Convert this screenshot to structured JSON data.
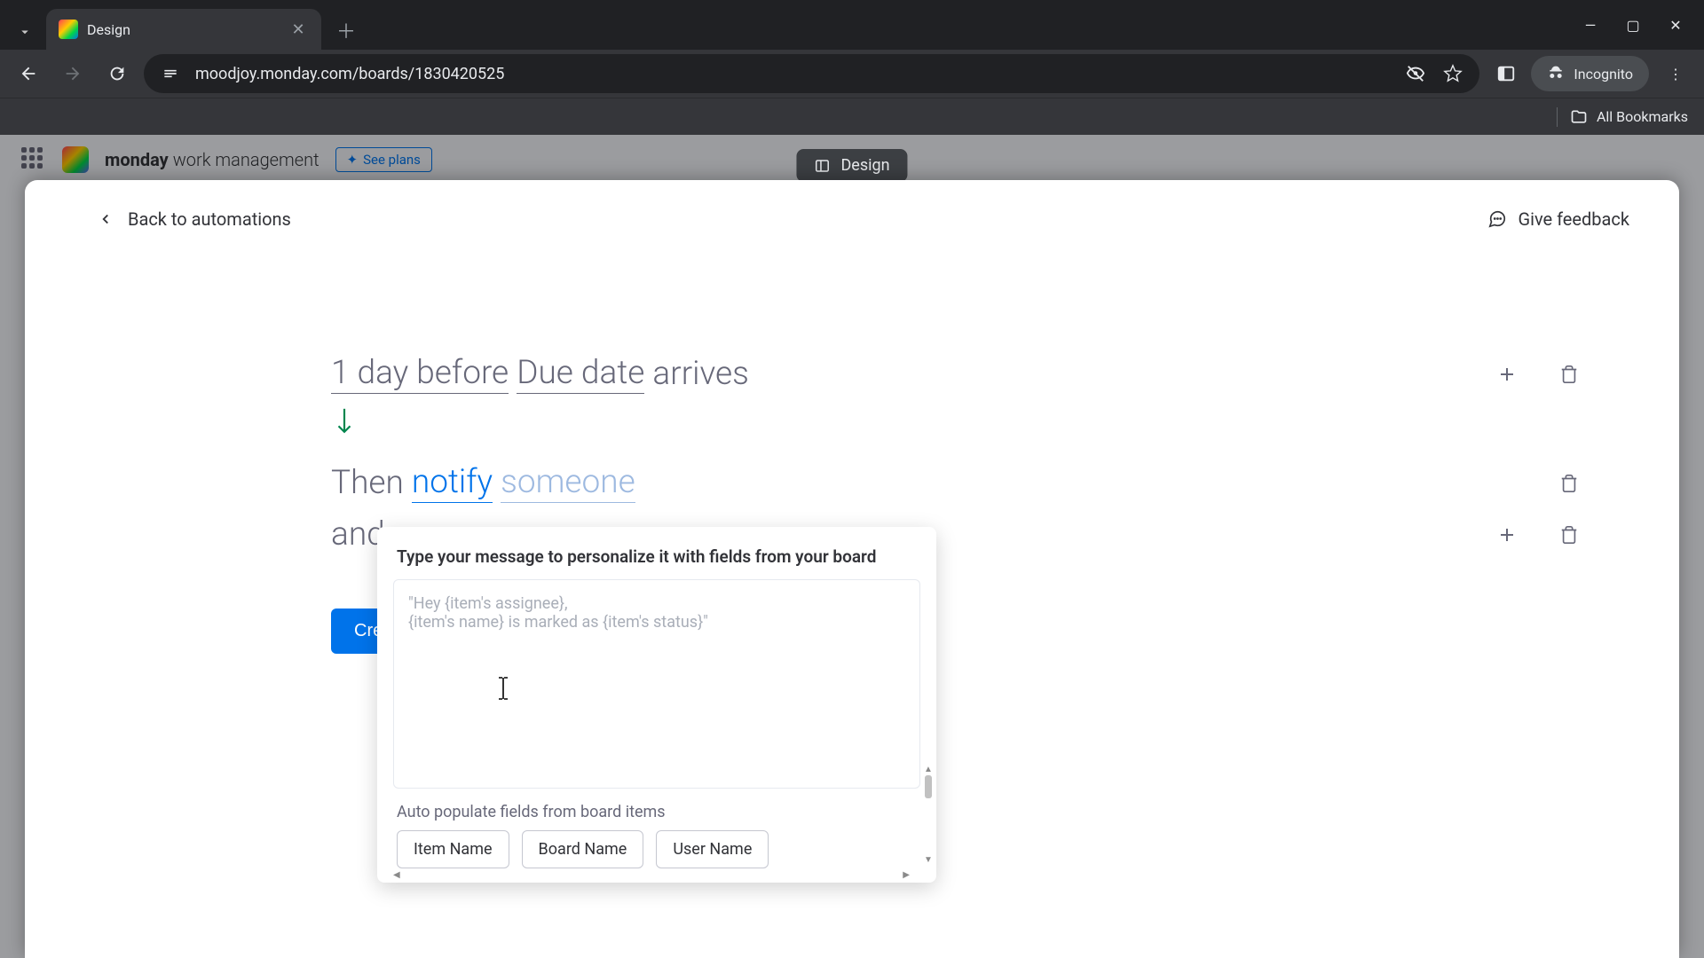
{
  "browser": {
    "tab_title": "Design",
    "url": "moodjoy.monday.com/boards/1830420525",
    "incognito_label": "Incognito",
    "all_bookmarks": "All Bookmarks"
  },
  "page_pill": "Design",
  "monday_header": {
    "brand_bold": "monday",
    "brand_rest": "work management",
    "see_plans": "See plans"
  },
  "modal": {
    "back": "Back to automations",
    "feedback": "Give feedback"
  },
  "automation": {
    "trigger": {
      "time": "1 day before",
      "date_field": "Due date",
      "suffix": "arrives"
    },
    "action1": {
      "prefix": "Then",
      "verb": "notify",
      "target": "someone"
    },
    "action2": {
      "prefix": "and"
    },
    "create_button": "Create automation"
  },
  "notify_popup": {
    "title": "Type your message to personalize it with fields from your board",
    "placeholder": "\"Hey {item's assignee},\n{item's name} is marked as {item's status}\"",
    "autopop_label": "Auto populate fields from board items",
    "chips": [
      "Item Name",
      "Board Name",
      "User Name"
    ]
  }
}
